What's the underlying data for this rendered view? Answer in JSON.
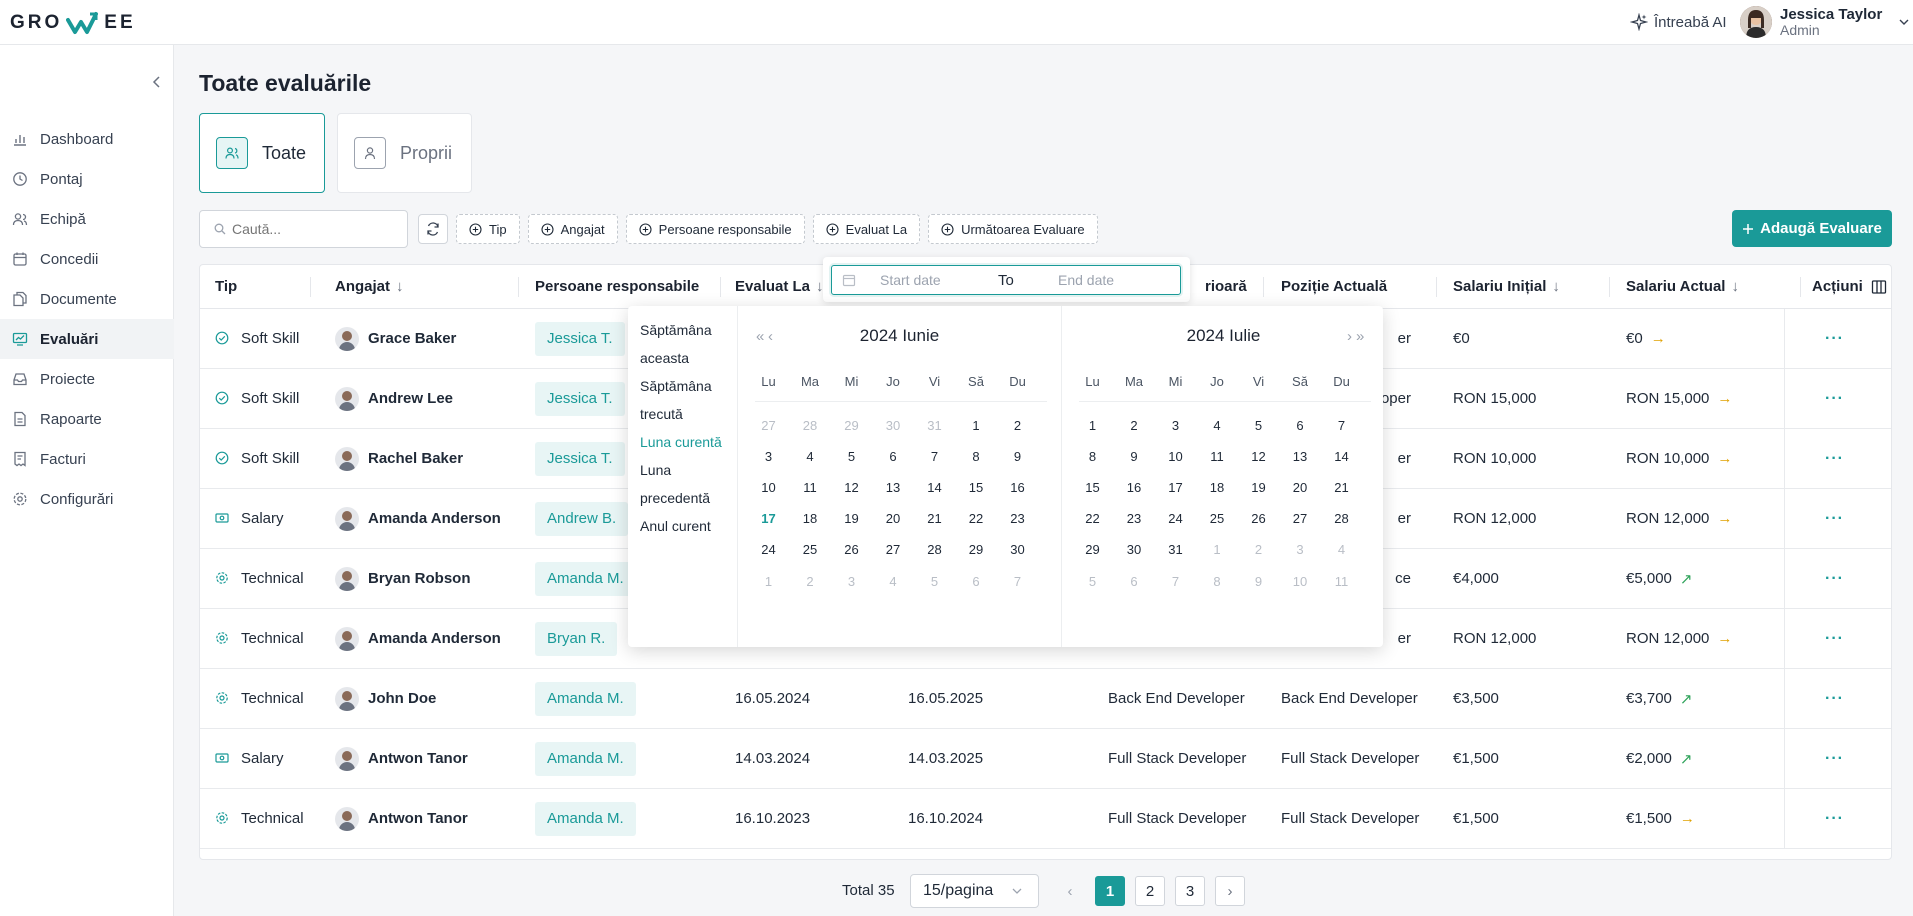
{
  "brand": {
    "logo_left": "GRO",
    "logo_right": "EE"
  },
  "topbar": {
    "ask_ai": "Întreabă AI",
    "user_name": "Jessica Taylor",
    "user_role": "Admin"
  },
  "sidebar": {
    "items": [
      {
        "label": "Dashboard",
        "icon": "bar-chart-icon"
      },
      {
        "label": "Pontaj",
        "icon": "clock-icon"
      },
      {
        "label": "Echipă",
        "icon": "users-icon"
      },
      {
        "label": "Concedii",
        "icon": "calendar-icon"
      },
      {
        "label": "Documente",
        "icon": "documents-icon"
      },
      {
        "label": "Evaluări",
        "icon": "evaluation-icon"
      },
      {
        "label": "Proiecte",
        "icon": "inbox-icon"
      },
      {
        "label": "Rapoarte",
        "icon": "report-icon"
      },
      {
        "label": "Facturi",
        "icon": "invoice-icon"
      },
      {
        "label": "Configurări",
        "icon": "gear-icon"
      }
    ]
  },
  "page": {
    "title": "Toate evaluările",
    "tab_all": "Toate",
    "tab_own": "Proprii"
  },
  "toolbar": {
    "search_placeholder": "Caută...",
    "filters": [
      "Tip",
      "Angajat",
      "Persoane responsabile",
      "Evaluat La",
      "Următoarea Evaluare"
    ],
    "add_button": "Adaugă Evaluare"
  },
  "table": {
    "headers": {
      "type": "Tip",
      "employee": "Angajat",
      "responsible": "Persoane responsabile",
      "evaluated": "Evaluat La",
      "prev_pos": "rioară",
      "curr_pos": "Poziție Actuală",
      "salary_init": "Salariu Inițial",
      "salary_curr": "Salariu Actual",
      "actions": "Acțiuni"
    },
    "rows": [
      {
        "type": "Soft Skill",
        "type_icon": "check-circle-icon",
        "employee": "Grace Baker",
        "responsible": "Jessica T.",
        "evaluated": "",
        "next": "",
        "prev": "",
        "curr": "er",
        "sal_init": "€0",
        "sal_curr": "€0",
        "trend": "flat"
      },
      {
        "type": "Soft Skill",
        "type_icon": "check-circle-icon",
        "employee": "Andrew Lee",
        "responsible": "Jessica T.",
        "evaluated": "",
        "next": "",
        "prev": "",
        "curr": "oper",
        "sal_init": "RON 15,000",
        "sal_curr": "RON 15,000",
        "trend": "flat"
      },
      {
        "type": "Soft Skill",
        "type_icon": "check-circle-icon",
        "employee": "Rachel Baker",
        "responsible": "Jessica T.",
        "evaluated": "",
        "next": "",
        "prev": "",
        "curr": "er",
        "sal_init": "RON 10,000",
        "sal_curr": "RON 10,000",
        "trend": "flat"
      },
      {
        "type": "Salary",
        "type_icon": "money-icon",
        "employee": "Amanda Anderson",
        "responsible": "Andrew B.",
        "evaluated": "",
        "next": "",
        "prev": "",
        "curr": "er",
        "sal_init": "RON 12,000",
        "sal_curr": "RON 12,000",
        "trend": "flat"
      },
      {
        "type": "Technical",
        "type_icon": "gear-icon",
        "employee": "Bryan Robson",
        "responsible": "Amanda M.",
        "evaluated": "",
        "next": "",
        "prev": "",
        "curr": "ce",
        "sal_init": "€4,000",
        "sal_curr": "€5,000",
        "trend": "up"
      },
      {
        "type": "Technical",
        "type_icon": "gear-icon",
        "employee": "Amanda Anderson",
        "responsible": "Bryan R.",
        "evaluated": "",
        "next": "",
        "prev": "",
        "curr": "er",
        "sal_init": "RON 12,000",
        "sal_curr": "RON 12,000",
        "trend": "flat"
      },
      {
        "type": "Technical",
        "type_icon": "gear-icon",
        "employee": "John Doe",
        "responsible": "Amanda M.",
        "evaluated": "16.05.2024",
        "next": "16.05.2025",
        "prev": "Back End Developer",
        "curr": "Back End Developer",
        "sal_init": "€3,500",
        "sal_curr": "€3,700",
        "trend": "up"
      },
      {
        "type": "Salary",
        "type_icon": "money-icon",
        "employee": "Antwon Tanor",
        "responsible": "Amanda M.",
        "evaluated": "14.03.2024",
        "next": "14.03.2025",
        "prev": "Full Stack Developer",
        "curr": "Full Stack Developer",
        "sal_init": "€1,500",
        "sal_curr": "€2,000",
        "trend": "up"
      },
      {
        "type": "Technical",
        "type_icon": "gear-icon",
        "employee": "Antwon Tanor",
        "responsible": "Amanda M.",
        "evaluated": "16.10.2023",
        "next": "16.10.2024",
        "prev": "Full Stack Developer",
        "curr": "Full Stack Developer",
        "sal_init": "€1,500",
        "sal_curr": "€1,500",
        "trend": "flat"
      }
    ]
  },
  "datepicker": {
    "start_placeholder": "Start date",
    "to_label": "To",
    "end_placeholder": "End date",
    "presets": [
      {
        "label": "Săptămâna\naceasta",
        "active": false
      },
      {
        "label": "Săptămâna\ntrecută",
        "active": false
      },
      {
        "label": "Luna curentă",
        "active": true
      },
      {
        "label": "Luna\nprecedentă",
        "active": false
      },
      {
        "label": "Anul curent",
        "active": false
      }
    ],
    "weekdays": [
      "Lu",
      "Ma",
      "Mi",
      "Jo",
      "Vi",
      "Să",
      "Du"
    ],
    "left": {
      "title": "2024 Iunie",
      "days": [
        "27",
        "28",
        "29",
        "30",
        "31",
        "1",
        "2",
        "3",
        "4",
        "5",
        "6",
        "7",
        "8",
        "9",
        "10",
        "11",
        "12",
        "13",
        "14",
        "15",
        "16",
        "17",
        "18",
        "19",
        "20",
        "21",
        "22",
        "23",
        "24",
        "25",
        "26",
        "27",
        "28",
        "29",
        "30",
        "1",
        "2",
        "3",
        "4",
        "5",
        "6",
        "7"
      ],
      "out": [
        0,
        1,
        2,
        3,
        4,
        35,
        36,
        37,
        38,
        39,
        40,
        41
      ],
      "today": 21
    },
    "right": {
      "title": "2024 Iulie",
      "days": [
        "1",
        "2",
        "3",
        "4",
        "5",
        "6",
        "7",
        "8",
        "9",
        "10",
        "11",
        "12",
        "13",
        "14",
        "15",
        "16",
        "17",
        "18",
        "19",
        "20",
        "21",
        "22",
        "23",
        "24",
        "25",
        "26",
        "27",
        "28",
        "29",
        "30",
        "31",
        "1",
        "2",
        "3",
        "4",
        "5",
        "6",
        "7",
        "8",
        "9",
        "10",
        "11"
      ],
      "out": [
        31,
        32,
        33,
        34,
        35,
        36,
        37,
        38,
        39,
        40,
        41
      ],
      "today": -1
    }
  },
  "pagination": {
    "total": "Total 35",
    "per_page": "15/pagina",
    "pages": [
      "1",
      "2",
      "3"
    ],
    "current": "1"
  },
  "colors": {
    "accent": "#1a9a98",
    "trend_flat": "#e0a100",
    "trend_up": "#2fa35a"
  }
}
